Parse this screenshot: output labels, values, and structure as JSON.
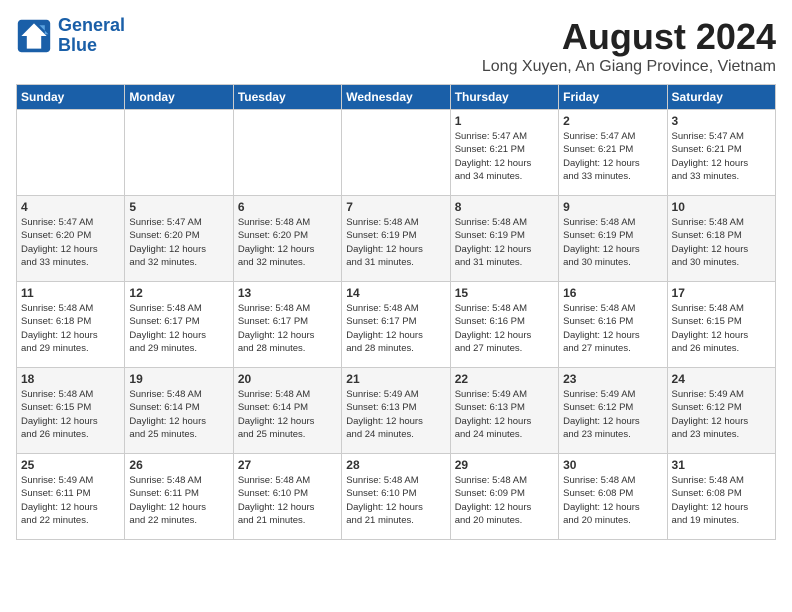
{
  "header": {
    "logo_line1": "General",
    "logo_line2": "Blue",
    "month_year": "August 2024",
    "location": "Long Xuyen, An Giang Province, Vietnam"
  },
  "days_of_week": [
    "Sunday",
    "Monday",
    "Tuesday",
    "Wednesday",
    "Thursday",
    "Friday",
    "Saturday"
  ],
  "weeks": [
    [
      {
        "day": "",
        "info": ""
      },
      {
        "day": "",
        "info": ""
      },
      {
        "day": "",
        "info": ""
      },
      {
        "day": "",
        "info": ""
      },
      {
        "day": "1",
        "info": "Sunrise: 5:47 AM\nSunset: 6:21 PM\nDaylight: 12 hours\nand 34 minutes."
      },
      {
        "day": "2",
        "info": "Sunrise: 5:47 AM\nSunset: 6:21 PM\nDaylight: 12 hours\nand 33 minutes."
      },
      {
        "day": "3",
        "info": "Sunrise: 5:47 AM\nSunset: 6:21 PM\nDaylight: 12 hours\nand 33 minutes."
      }
    ],
    [
      {
        "day": "4",
        "info": "Sunrise: 5:47 AM\nSunset: 6:20 PM\nDaylight: 12 hours\nand 33 minutes."
      },
      {
        "day": "5",
        "info": "Sunrise: 5:47 AM\nSunset: 6:20 PM\nDaylight: 12 hours\nand 32 minutes."
      },
      {
        "day": "6",
        "info": "Sunrise: 5:48 AM\nSunset: 6:20 PM\nDaylight: 12 hours\nand 32 minutes."
      },
      {
        "day": "7",
        "info": "Sunrise: 5:48 AM\nSunset: 6:19 PM\nDaylight: 12 hours\nand 31 minutes."
      },
      {
        "day": "8",
        "info": "Sunrise: 5:48 AM\nSunset: 6:19 PM\nDaylight: 12 hours\nand 31 minutes."
      },
      {
        "day": "9",
        "info": "Sunrise: 5:48 AM\nSunset: 6:19 PM\nDaylight: 12 hours\nand 30 minutes."
      },
      {
        "day": "10",
        "info": "Sunrise: 5:48 AM\nSunset: 6:18 PM\nDaylight: 12 hours\nand 30 minutes."
      }
    ],
    [
      {
        "day": "11",
        "info": "Sunrise: 5:48 AM\nSunset: 6:18 PM\nDaylight: 12 hours\nand 29 minutes."
      },
      {
        "day": "12",
        "info": "Sunrise: 5:48 AM\nSunset: 6:17 PM\nDaylight: 12 hours\nand 29 minutes."
      },
      {
        "day": "13",
        "info": "Sunrise: 5:48 AM\nSunset: 6:17 PM\nDaylight: 12 hours\nand 28 minutes."
      },
      {
        "day": "14",
        "info": "Sunrise: 5:48 AM\nSunset: 6:17 PM\nDaylight: 12 hours\nand 28 minutes."
      },
      {
        "day": "15",
        "info": "Sunrise: 5:48 AM\nSunset: 6:16 PM\nDaylight: 12 hours\nand 27 minutes."
      },
      {
        "day": "16",
        "info": "Sunrise: 5:48 AM\nSunset: 6:16 PM\nDaylight: 12 hours\nand 27 minutes."
      },
      {
        "day": "17",
        "info": "Sunrise: 5:48 AM\nSunset: 6:15 PM\nDaylight: 12 hours\nand 26 minutes."
      }
    ],
    [
      {
        "day": "18",
        "info": "Sunrise: 5:48 AM\nSunset: 6:15 PM\nDaylight: 12 hours\nand 26 minutes."
      },
      {
        "day": "19",
        "info": "Sunrise: 5:48 AM\nSunset: 6:14 PM\nDaylight: 12 hours\nand 25 minutes."
      },
      {
        "day": "20",
        "info": "Sunrise: 5:48 AM\nSunset: 6:14 PM\nDaylight: 12 hours\nand 25 minutes."
      },
      {
        "day": "21",
        "info": "Sunrise: 5:49 AM\nSunset: 6:13 PM\nDaylight: 12 hours\nand 24 minutes."
      },
      {
        "day": "22",
        "info": "Sunrise: 5:49 AM\nSunset: 6:13 PM\nDaylight: 12 hours\nand 24 minutes."
      },
      {
        "day": "23",
        "info": "Sunrise: 5:49 AM\nSunset: 6:12 PM\nDaylight: 12 hours\nand 23 minutes."
      },
      {
        "day": "24",
        "info": "Sunrise: 5:49 AM\nSunset: 6:12 PM\nDaylight: 12 hours\nand 23 minutes."
      }
    ],
    [
      {
        "day": "25",
        "info": "Sunrise: 5:49 AM\nSunset: 6:11 PM\nDaylight: 12 hours\nand 22 minutes."
      },
      {
        "day": "26",
        "info": "Sunrise: 5:48 AM\nSunset: 6:11 PM\nDaylight: 12 hours\nand 22 minutes."
      },
      {
        "day": "27",
        "info": "Sunrise: 5:48 AM\nSunset: 6:10 PM\nDaylight: 12 hours\nand 21 minutes."
      },
      {
        "day": "28",
        "info": "Sunrise: 5:48 AM\nSunset: 6:10 PM\nDaylight: 12 hours\nand 21 minutes."
      },
      {
        "day": "29",
        "info": "Sunrise: 5:48 AM\nSunset: 6:09 PM\nDaylight: 12 hours\nand 20 minutes."
      },
      {
        "day": "30",
        "info": "Sunrise: 5:48 AM\nSunset: 6:08 PM\nDaylight: 12 hours\nand 20 minutes."
      },
      {
        "day": "31",
        "info": "Sunrise: 5:48 AM\nSunset: 6:08 PM\nDaylight: 12 hours\nand 19 minutes."
      }
    ]
  ]
}
